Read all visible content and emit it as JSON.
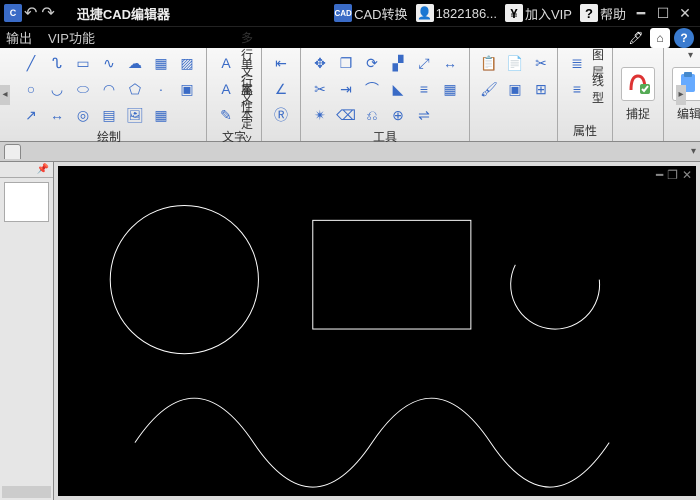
{
  "app": {
    "title": "迅捷CAD编辑器"
  },
  "titlebar": {
    "cad_convert": "CAD转换",
    "phone": "1822186...",
    "join_vip": "加入VIP",
    "help": "帮助"
  },
  "menubar": {
    "export": "输出",
    "vip": "VIP功能"
  },
  "ribbon": {
    "draw": "绘制",
    "text": "文字",
    "tools": "工具",
    "props": "属性",
    "snap": "捕捉",
    "edit": "编辑",
    "multiline_text": "多行文本",
    "singleline_text": "单行文本",
    "attr_def": "属性定义",
    "layer": "图层",
    "linetype": "线型"
  }
}
